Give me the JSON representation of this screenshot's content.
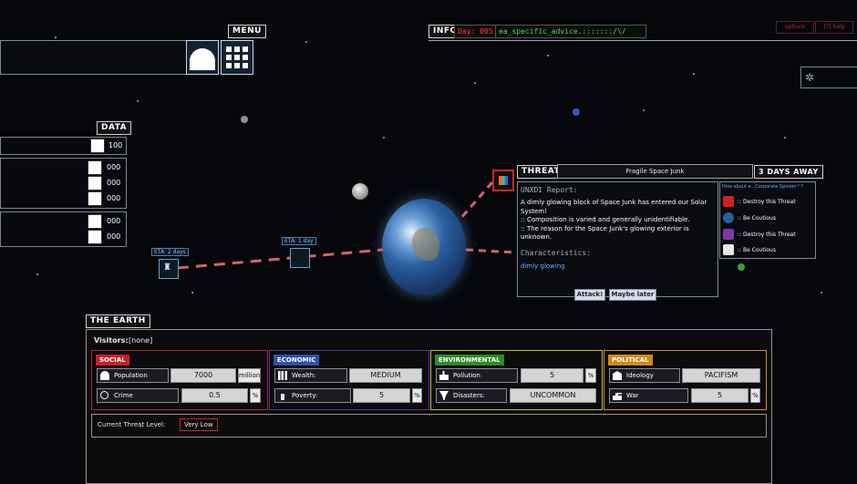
{
  "header": {
    "menu_label": "MENU",
    "info_label": "INFO",
    "day": "Day: 005",
    "advice": "ea_specific_advice.:::::::/\\/",
    "options_label": "options",
    "help_label": "[?] help"
  },
  "data_panel": {
    "label": "DATA",
    "rows": [
      {
        "icon": "document-icon",
        "value": "100"
      },
      {
        "icon": "grid-icon",
        "value": "000"
      },
      {
        "icon": "stairs-icon",
        "value": "000"
      },
      {
        "icon": "corner-icon",
        "value": "000"
      },
      {
        "icon": "bot-icon",
        "value": "000"
      },
      {
        "icon": "person-icon",
        "value": "000"
      }
    ]
  },
  "map": {
    "eta_2": "ETA: 2 days",
    "eta_1": "ETA: 1 day"
  },
  "threat": {
    "label": "THREAT",
    "name": "Fragile Space Junk",
    "distance": "3 DAYS AWAY",
    "report_title": "UNXDI Report:",
    "report_body": "A dimly glowing block of Space Junk has entered our Solar System!\n:: Composition is varied and generally unidentifiable.\n:: The reason for the Space Junk's glowing exterior is unknown.",
    "characteristics_title": "Characteristics:",
    "characteristic": "dimly glowing",
    "attack_button": "Attack!",
    "later_button": "Maybe later"
  },
  "advisors": {
    "title": "How about a...Corporate Spinion™?",
    "items": [
      {
        "icon": "p-logo-icon",
        "text": ":: Destroy this Threat",
        "color": "#d21f1f"
      },
      {
        "icon": "globe-logo-icon",
        "text": ":: Be Coutious",
        "color": "#2a5d9e"
      },
      {
        "icon": "grid-logo-icon",
        "text": ":: Destroy this Threat",
        "color": "#7b3aa8"
      },
      {
        "icon": "bars-logo-icon",
        "text": ":: Be Coutious",
        "color": "#e6e6e6"
      }
    ]
  },
  "earth": {
    "label": "THE EARTH",
    "visitors_label": "Visitors:",
    "visitors_value": "[none]",
    "social": {
      "title": "SOCIAL",
      "color": "#c8202a",
      "population_label": "Population",
      "population_value": "7000",
      "population_unit": "million",
      "crime_label": "Crime",
      "crime_value": "0.5",
      "crime_unit": "%"
    },
    "economic": {
      "title": "ECONOMIC",
      "color": "#2f4fa8",
      "wealth_label": "Wealth:",
      "wealth_value": "MEDIUM",
      "poverty_label": "Poverty:",
      "poverty_value": "5",
      "poverty_unit": "%"
    },
    "environmental": {
      "title": "ENVIRONMENTAL",
      "color": "#2e8a2a",
      "pollution_label": "Pollution",
      "pollution_value": "5",
      "pollution_unit": "%",
      "disasters_label": "Disasters:",
      "disasters_value": "UNCOMMON"
    },
    "political": {
      "title": "POLITICAL",
      "color": "#cf8a1b",
      "ideology_label": "Ideology",
      "ideology_value": "PACIFISM",
      "war_label": "War",
      "war_value": "5",
      "war_unit": "%"
    },
    "threat_level_label": "Current Threat Level:",
    "threat_level_value": "Very Low"
  }
}
